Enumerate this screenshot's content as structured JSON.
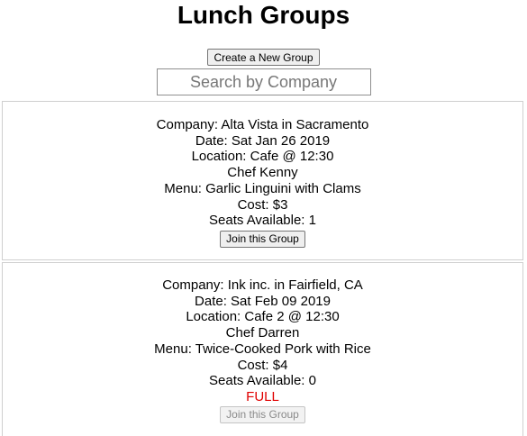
{
  "page": {
    "title": "Lunch Groups",
    "create_button_label": "Create a New Group",
    "search_placeholder": "Search by Company",
    "search_value": ""
  },
  "groups": [
    {
      "company_line": "Company: Alta Vista in Sacramento",
      "date_line": "Date: Sat Jan 26 2019",
      "location_line": "Location: Cafe @ 12:30",
      "chef_line": "Chef Kenny",
      "menu_line": "Menu: Garlic Linguini with Clams",
      "cost_line": "Cost: $3",
      "seats_line": "Seats Available: 1",
      "status": "",
      "join_label": "Join this Group",
      "join_enabled": true
    },
    {
      "company_line": "Company: Ink inc. in Fairfield, CA",
      "date_line": "Date: Sat Feb 09 2019",
      "location_line": "Location: Cafe 2 @ 12:30",
      "chef_line": "Chef Darren",
      "menu_line": "Menu: Twice-Cooked Pork with Rice",
      "cost_line": "Cost: $4",
      "seats_line": "Seats Available: 0",
      "status": "FULL",
      "join_label": "Join this Group",
      "join_enabled": false
    }
  ],
  "colors": {
    "full_status": "#e00000",
    "card_border": "#cfcfcf"
  }
}
